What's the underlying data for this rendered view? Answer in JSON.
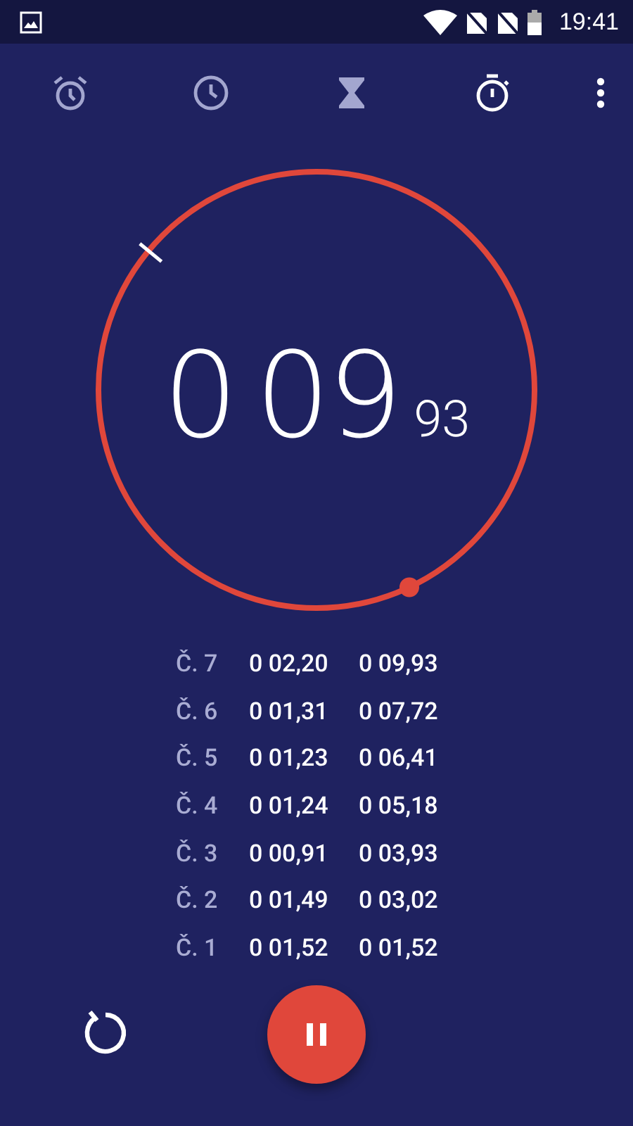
{
  "status_bar": {
    "time": "19:41"
  },
  "tabs": [
    {
      "kind": "alarm",
      "selected": false
    },
    {
      "kind": "clock",
      "selected": false
    },
    {
      "kind": "timer",
      "selected": false
    },
    {
      "kind": "stopwatch",
      "selected": true
    }
  ],
  "dial": {
    "minutes": "0",
    "seconds": "09",
    "hundredths": "93"
  },
  "laps": [
    {
      "label": "Č. 7",
      "lap_time": "0 02,20",
      "total": "0 09,93"
    },
    {
      "label": "Č. 6",
      "lap_time": "0 01,31",
      "total": "0 07,72"
    },
    {
      "label": "Č. 5",
      "lap_time": "0 01,23",
      "total": "0 06,41"
    },
    {
      "label": "Č. 4",
      "lap_time": "0 01,24",
      "total": "0 05,18"
    },
    {
      "label": "Č. 3",
      "lap_time": "0 00,91",
      "total": "0 03,93"
    },
    {
      "label": "Č. 2",
      "lap_time": "0 01,49",
      "total": "0 03,02"
    },
    {
      "label": "Č. 1",
      "lap_time": "0 01,52",
      "total": "0 01,52"
    }
  ],
  "controls": {
    "running": true
  }
}
